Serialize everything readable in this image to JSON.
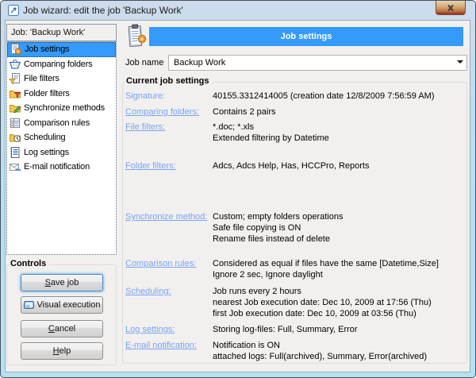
{
  "window": {
    "title": "Job wizard: edit the job 'Backup Work'"
  },
  "sidebar": {
    "header": "Job: 'Backup Work'",
    "items": [
      {
        "label": "Job settings",
        "icon": "job-settings",
        "selected": true
      },
      {
        "label": "Comparing folders",
        "icon": "comparing-folders",
        "selected": false
      },
      {
        "label": "File filters",
        "icon": "file-filters",
        "selected": false
      },
      {
        "label": "Folder filters",
        "icon": "folder-filters",
        "selected": false
      },
      {
        "label": "Synchronize methods",
        "icon": "synchronize-methods",
        "selected": false
      },
      {
        "label": "Comparison rules",
        "icon": "comparison-rules",
        "selected": false
      },
      {
        "label": "Scheduling",
        "icon": "scheduling",
        "selected": false
      },
      {
        "label": "Log settings",
        "icon": "log-settings",
        "selected": false
      },
      {
        "label": "E-mail notification",
        "icon": "email-notification",
        "selected": false
      }
    ]
  },
  "controls": {
    "caption": "Controls",
    "buttons": [
      {
        "label": "Save job",
        "underline": "S",
        "default": true
      },
      {
        "label": "Visual execution",
        "icon": "visual-execution"
      },
      {
        "label": "Cancel",
        "underline": "C"
      },
      {
        "label": "Help",
        "underline": "H"
      }
    ]
  },
  "main": {
    "banner": "Job settings",
    "job_name_label": "Job name",
    "job_name_value": "Backup Work",
    "group_caption": "Current job settings",
    "settings": [
      {
        "label": "Signature:",
        "underlined": false,
        "lines": [
          "40155.3312414005 (creation date 12/8/2009 7:56:59 AM)"
        ]
      },
      {
        "label": "Comparing folders:",
        "underlined": true,
        "lines": [
          "Contains 2 pairs"
        ]
      },
      {
        "label": "File filters:",
        "underlined": true,
        "lines": [
          "*.doc; *.xls",
          "Extended filtering by Datetime"
        ]
      },
      {
        "label": "Folder filters:",
        "underlined": true,
        "lines": [
          "Adcs, Adcs Help, Has, HCCPro, Reports"
        ]
      },
      {
        "label": "Synchronize method:",
        "underlined": true,
        "lines": [
          "Custom; empty folders operations",
          "Safe file copying is ON",
          "Rename files instead of delete"
        ]
      },
      {
        "label": "Comparison rules:",
        "underlined": true,
        "lines": [
          "Considered as equal if files have the same [Datetime,Size]",
          "Ignore 2 sec, Ignore daylight"
        ]
      },
      {
        "label": "Scheduling:",
        "underlined": true,
        "lines": [
          "Job runs every 2 hours",
          "nearest Job execution date: Dec 10, 2009 at 17:56 (Thu)",
          "first Job execution date: Dec 10, 2009 at 03:56 (Thu)"
        ]
      },
      {
        "label": "Log settings:",
        "underlined": true,
        "lines": [
          "Storing log-files: Full, Summary, Error"
        ]
      },
      {
        "label": "E-mail notification:",
        "underlined": true,
        "lines": [
          "Notification is ON",
          "attached logs: Full(archived), Summary, Error(archived)"
        ]
      }
    ]
  },
  "colors": {
    "accent": "#349afc",
    "link": "#78a1f0"
  }
}
